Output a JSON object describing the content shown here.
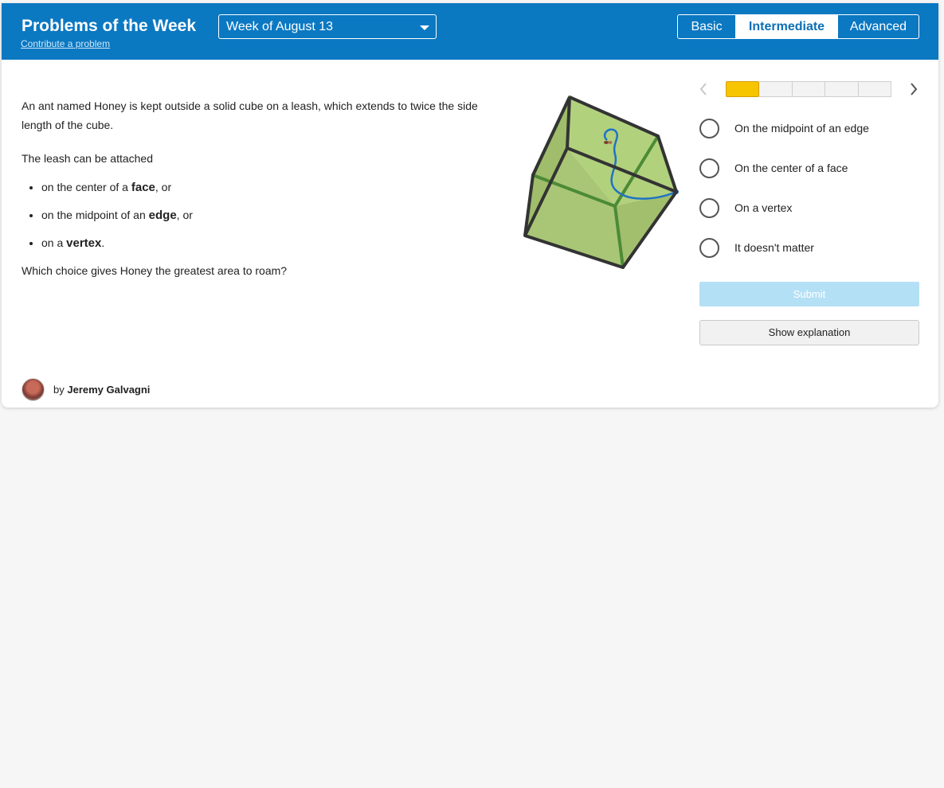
{
  "header": {
    "title": "Problems of the Week",
    "contribute_link": "Contribute a problem",
    "week_select": "Week of August 13",
    "levels": [
      "Basic",
      "Intermediate",
      "Advanced"
    ],
    "active_level": "Intermediate"
  },
  "problem": {
    "intro": "An ant named Honey is kept outside a solid cube on a leash, which extends to twice the side length of the cube.",
    "attached": "The leash can be attached",
    "bullets": [
      {
        "pre": "on the center of a ",
        "bold": "face",
        "post": ", or"
      },
      {
        "pre": "on the midpoint of an ",
        "bold": "edge",
        "post": ", or"
      },
      {
        "pre": "on a ",
        "bold": "vertex",
        "post": "."
      }
    ],
    "question": "Which choice gives Honey the greatest area to roam?"
  },
  "progress": {
    "total_segments": 5,
    "current_segment": 1
  },
  "options": [
    "On the midpoint of an edge",
    "On the center of a face",
    "On a vertex",
    "It doesn't matter"
  ],
  "buttons": {
    "submit": "Submit",
    "show_explanation": "Show explanation"
  },
  "author": {
    "by": "by",
    "name": "Jeremy Galvagni"
  },
  "colors": {
    "header_bg": "#0b78c2",
    "progress_current": "#f7c400",
    "submit_bg": "#b4e0f6",
    "cube_face": "#a9c676",
    "leash": "#1f73c4"
  }
}
